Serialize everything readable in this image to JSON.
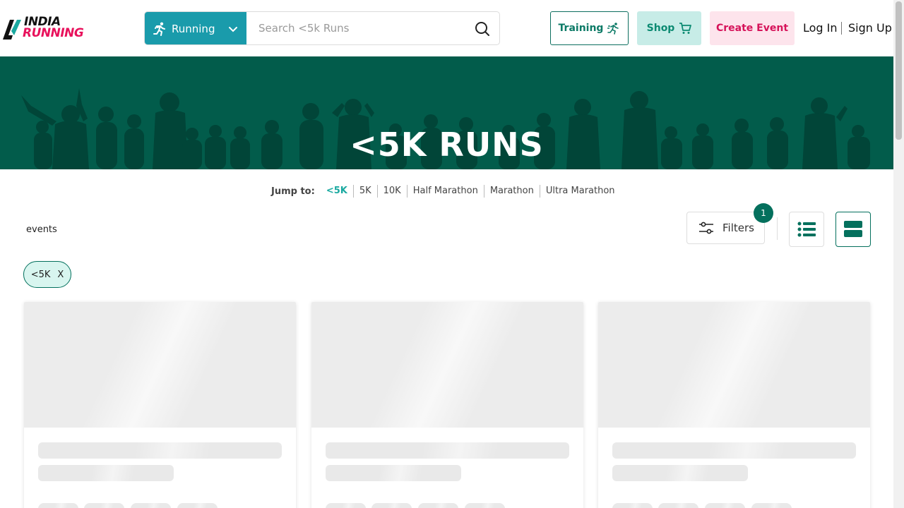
{
  "header": {
    "logo_line1": "INDIA",
    "logo_line2": "RUNNING",
    "sport_select": {
      "value": "Running"
    },
    "search": {
      "placeholder": "Search <5k Runs",
      "value": ""
    },
    "buttons": {
      "training": "Training",
      "shop": "Shop",
      "create_event": "Create Event"
    },
    "auth": {
      "login": "Log In",
      "signup": "Sign Up"
    }
  },
  "hero": {
    "title": "<5K RUNS"
  },
  "jump_to": {
    "label": "Jump to:",
    "links": [
      "<5K",
      "5K",
      "10K",
      "Half Marathon",
      "Marathon",
      "Ultra Marathon"
    ],
    "active": "<5K"
  },
  "results": {
    "events_label": "events",
    "filters_label": "Filters",
    "filters_count": "1",
    "active_chip": {
      "label": "<5K",
      "remove": "X"
    }
  },
  "colors": {
    "brand_teal": "#1a9bab",
    "hero_green": "#025c4b",
    "accent_green": "#04705d",
    "brand_pink": "#e8125c"
  },
  "icons": {
    "sport": "runner-icon",
    "search": "search-icon",
    "training": "running-sprint-icon",
    "shop": "cart-icon",
    "filters": "sliders-icon",
    "list_view": "list-view-icon",
    "grid_view": "card-view-icon"
  }
}
